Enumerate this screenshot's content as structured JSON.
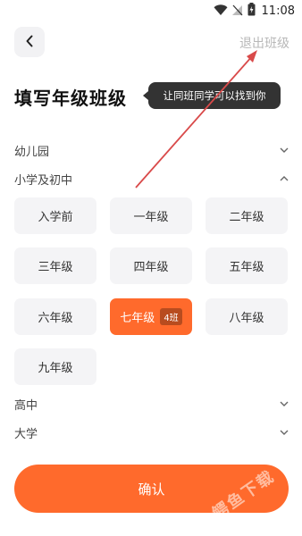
{
  "status_bar": {
    "time": "11:08",
    "icons": [
      "wifi-icon",
      "no-signal-icon",
      "battery-icon"
    ]
  },
  "header": {
    "back_icon": "chevron-left-icon",
    "exit_label": "退出班级"
  },
  "title": "填写年级班级",
  "tooltip": "让同班同学可以找到你",
  "sections": {
    "kindergarten": "幼儿园",
    "primary_middle": "小学及初中",
    "high_school": "高中",
    "university": "大学"
  },
  "grades": [
    {
      "label": "入学前"
    },
    {
      "label": "一年级"
    },
    {
      "label": "二年级"
    },
    {
      "label": "三年级"
    },
    {
      "label": "四年级"
    },
    {
      "label": "五年级"
    },
    {
      "label": "六年级"
    },
    {
      "label": "七年级",
      "selected": true,
      "class_badge": "4班"
    },
    {
      "label": "八年级"
    },
    {
      "label": "九年级"
    }
  ],
  "confirm_label": "确认",
  "watermark": "鳄鱼下载",
  "colors": {
    "accent": "#ff6a2c",
    "tooltip_bg": "#333333",
    "annotation_arrow": "#d94a4a"
  }
}
